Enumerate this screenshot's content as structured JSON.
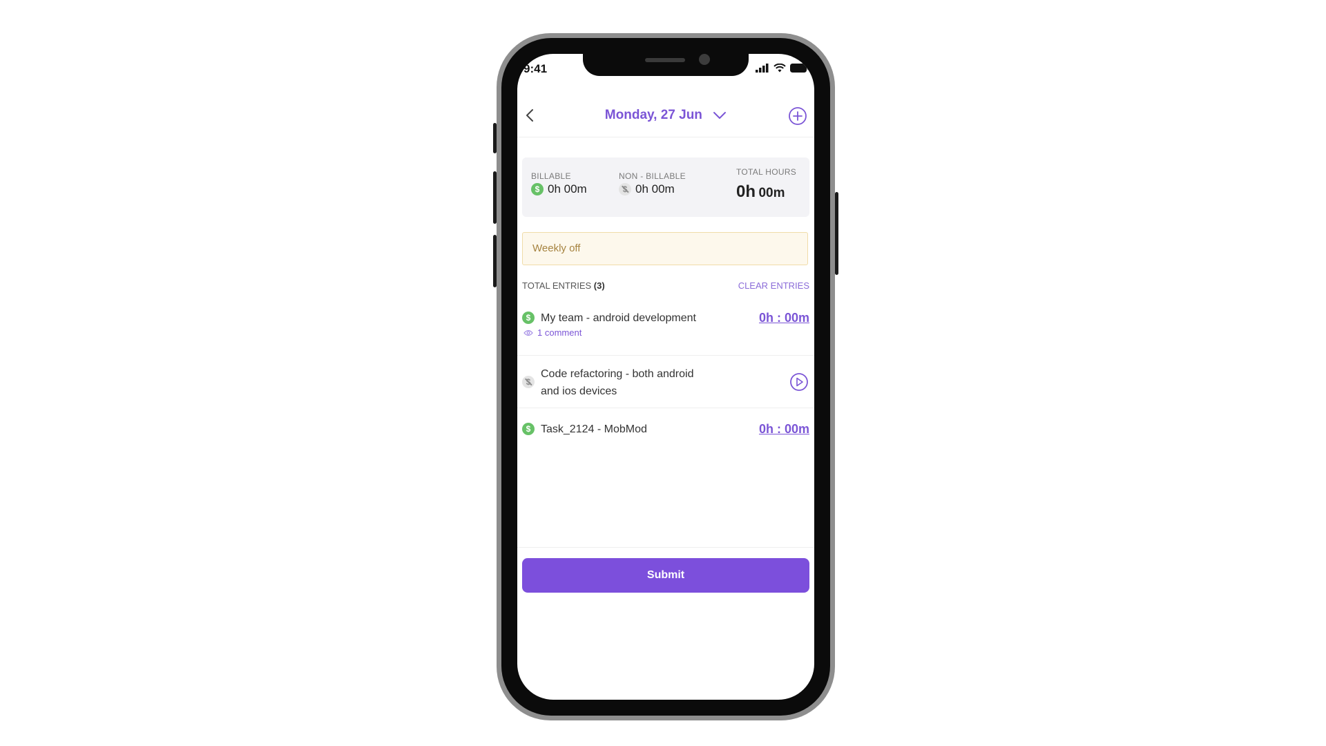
{
  "status_bar": {
    "time": "9:41",
    "icons": [
      "signal-icon",
      "wifi-icon",
      "battery-icon"
    ]
  },
  "header": {
    "date": "Monday, 27 Jun",
    "back_icon": "chevron-left-icon",
    "dropdown_icon": "chevron-down-icon",
    "add_icon": "plus-circle-icon"
  },
  "summary": {
    "billable_label": "BILLABLE",
    "billable_value": "0h 00m",
    "non_billable_label": "NON - BILLABLE",
    "non_billable_value": "0h 00m",
    "total_label": "TOTAL HOURS",
    "total_hours": "0h",
    "total_minutes": "00m"
  },
  "notice": {
    "text": "Weekly off"
  },
  "entries": {
    "label": "TOTAL ENTRIES",
    "count": "(3)",
    "clear_label": "CLEAR ENTRIES",
    "items": [
      {
        "title": "My team - android development",
        "billable": true,
        "time": "0h : 00m",
        "comment": "1 comment"
      },
      {
        "title_line1": "Code refactoring - both android",
        "title_line2": "and ios devices",
        "billable": false,
        "action": "play-icon"
      },
      {
        "title": "Task_2124 - MobMod",
        "billable": true,
        "time": "0h : 00m"
      }
    ]
  },
  "footer": {
    "submit_label": "Submit"
  },
  "colors": {
    "accent": "#7b55d6",
    "submit": "#7c4fdc",
    "billable_green": "#67c167",
    "notice_bg": "#fdf8ec",
    "notice_border": "#f0dca8",
    "notice_text": "#a68340"
  }
}
